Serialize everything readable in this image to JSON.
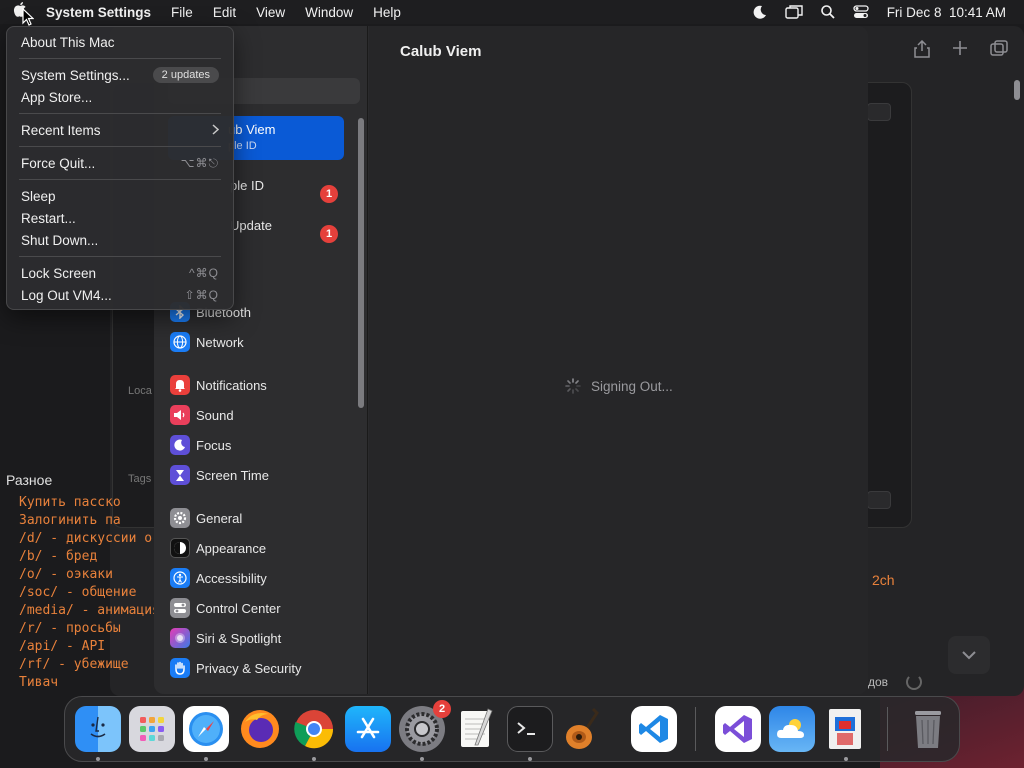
{
  "menubar": {
    "app_name": "System Settings",
    "menus": [
      "File",
      "Edit",
      "View",
      "Window",
      "Help"
    ],
    "datetime": "Fri Dec 8  10:41 AM"
  },
  "apple_menu": {
    "about": "About This Mac",
    "system_settings": "System Settings...",
    "updates_pill": "2 updates",
    "app_store": "App Store...",
    "recent_items": "Recent Items",
    "force_quit": "Force Quit...",
    "force_quit_shortcut": "⌥⌘⎋",
    "sleep": "Sleep",
    "restart": "Restart...",
    "shut_down": "Shut Down...",
    "lock_screen": "Lock Screen",
    "lock_screen_shortcut": "^⌘Q",
    "log_out": "Log Out VM4...",
    "log_out_shortcut": "⇧⌘Q"
  },
  "settings": {
    "main_title": "Calub Viem",
    "status": "Signing Out...",
    "user_card": {
      "name_partial": "ub Viem",
      "sub_partial": "ple ID"
    },
    "apple_id_partial": "ple ID",
    "apple_id_badge": "1",
    "update_partial": "Update",
    "update_badge": "1",
    "sidebar": {
      "bluetooth": "Bluetooth",
      "network": "Network",
      "notifications": "Notifications",
      "sound": "Sound",
      "focus": "Focus",
      "screen_time": "Screen Time",
      "general": "General",
      "appearance": "Appearance",
      "accessibility": "Accessibility",
      "control_center": "Control Center",
      "siri_spotlight": "Siri & Spotlight",
      "privacy_security": "Privacy & Security"
    }
  },
  "browser": {
    "panel_label_1": "Loca",
    "panel_label_2": "Tags",
    "side_text": "2ch",
    "bottom_text": "дов",
    "section_heading": "Разное",
    "links": [
      "Купить пасско",
      "Залогинить па",
      "/d/ - дискуссии о дв",
      "/b/ - бред",
      "/o/ - оэкаки",
      "/soc/ - общение",
      "/media/ - анимация",
      "/r/ - просьбы",
      "/api/ - API",
      "/rf/ - убежище",
      "Тивач"
    ]
  },
  "dock": {
    "apps": [
      "Finder",
      "Launchpad",
      "Safari",
      "Firefox",
      "Chrome",
      "App Store",
      "System Settings",
      "TextEdit",
      "Terminal",
      "GarageBand",
      "Visual Studio Code",
      "Visual Studio",
      "Weather",
      "Remote Desktop",
      "Trash"
    ],
    "settings_badge": "2"
  }
}
